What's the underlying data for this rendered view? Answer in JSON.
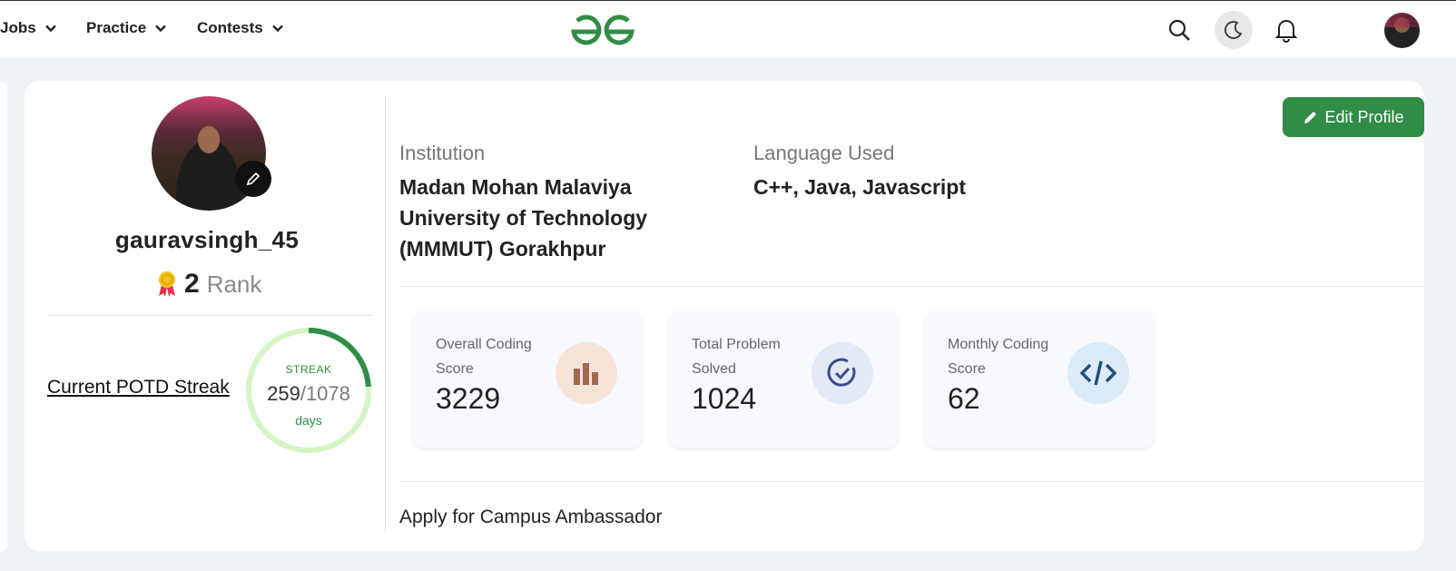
{
  "nav": {
    "items": [
      {
        "label": "Jobs"
      },
      {
        "label": "Practice"
      },
      {
        "label": "Contests"
      }
    ]
  },
  "profile": {
    "username": "gauravsingh_45",
    "rank_value": "2",
    "rank_label": "Rank",
    "potd_link": "Current POTD Streak",
    "streak": {
      "label": "STREAK",
      "current": "259",
      "total": "/1078",
      "unit": "days",
      "progress_fraction": 0.24
    }
  },
  "edit_profile_label": "Edit Profile",
  "institution": {
    "label": "Institution",
    "lines": [
      "Madan Mohan Malaviya",
      "University of Technology",
      "(MMMUT) Gorakhpur"
    ]
  },
  "languages": {
    "label": "Language Used",
    "value": "C++, Java, Javascript"
  },
  "stats": [
    {
      "title": "Overall Coding Score",
      "value": "3229",
      "icon": "bar-chart-icon"
    },
    {
      "title": "Total Problem Solved",
      "value": "1024",
      "icon": "check-circle-icon"
    },
    {
      "title": "Monthly Coding Score",
      "value": "62",
      "icon": "code-icon"
    }
  ],
  "campus_link": "Apply for Campus Ambassador",
  "colors": {
    "brand_green": "#2f8d46",
    "streak_track": "#d4f5c4",
    "page_bg": "#eef2f5"
  }
}
